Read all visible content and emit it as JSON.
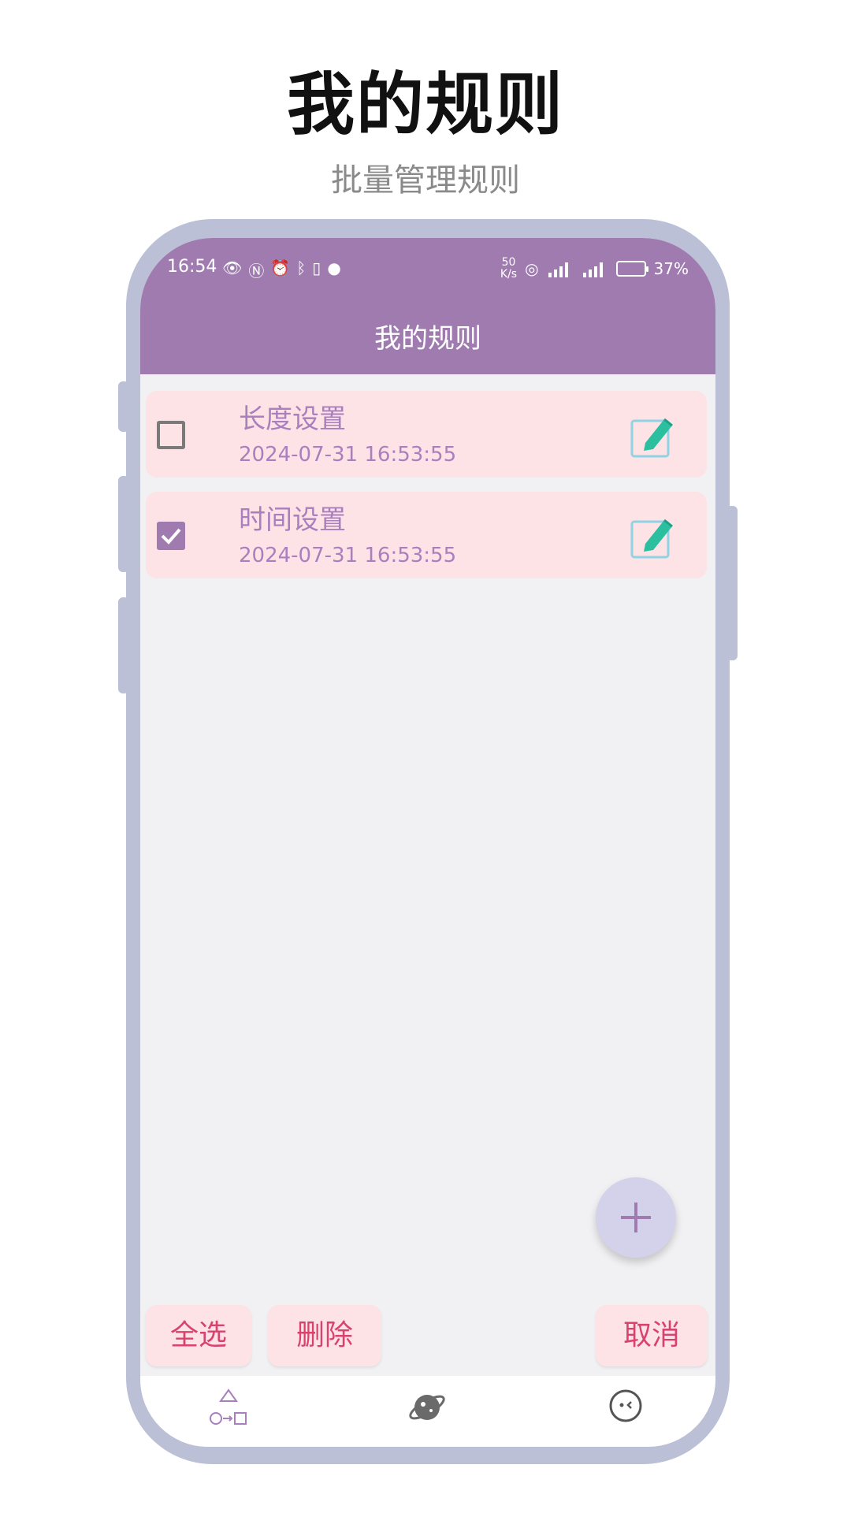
{
  "promo": {
    "title": "我的规则",
    "subtitle": "批量管理规则"
  },
  "status_bar": {
    "time": "16:54",
    "net_speed_value": "50",
    "net_speed_unit": "K/s",
    "battery": "37%"
  },
  "app": {
    "title": "我的规则"
  },
  "rules": [
    {
      "name": "长度设置",
      "date": "2024-07-31 16:53:55",
      "checked": false
    },
    {
      "name": "时间设置",
      "date": "2024-07-31 16:53:55",
      "checked": true
    }
  ],
  "actions": {
    "select_all": "全选",
    "delete": "删除",
    "cancel": "取消"
  },
  "icons": {
    "fab": "plus-icon",
    "edit": "edit-note-icon",
    "nav": [
      "shapes-icon",
      "planet-icon",
      "face-icon"
    ]
  },
  "colors": {
    "header": "#9f7bb0",
    "card": "#fde2e6",
    "card_text": "#a97fbe",
    "action_text": "#d8436d",
    "fab": "#d4d2ea",
    "frame": "#bcc0d7"
  }
}
